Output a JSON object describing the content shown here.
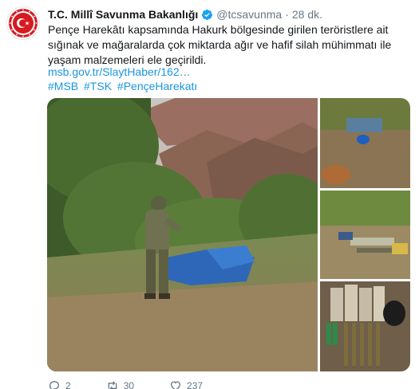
{
  "tweet": {
    "display_name": "T.C. Millî Savunma Bakanlığı",
    "handle": "@tcsavunma",
    "separator": "·",
    "time": "28 dk.",
    "text": "Pençe Harekâtı kapsamında Hakurk bölgesinde girilen teröristlere ait sığınak ve mağaralarda çok miktarda ağır ve hafif silah mühimmatı ile yaşam malzemeleri ele geçirildi.",
    "link": "msb.gov.tr/SlaytHaber/162…",
    "hashtags": [
      "#MSB",
      "#TSK",
      "#PençeHarekatı"
    ],
    "replies": "2",
    "retweets": "30",
    "likes": "237"
  },
  "colors": {
    "accent": "#1b95e0",
    "muted": "#657786",
    "text": "#14171a",
    "avatar_red": "#d71920"
  },
  "icons": {
    "verified": "verified-badge-icon",
    "reply": "reply-icon",
    "retweet": "retweet-icon",
    "like": "heart-icon"
  }
}
